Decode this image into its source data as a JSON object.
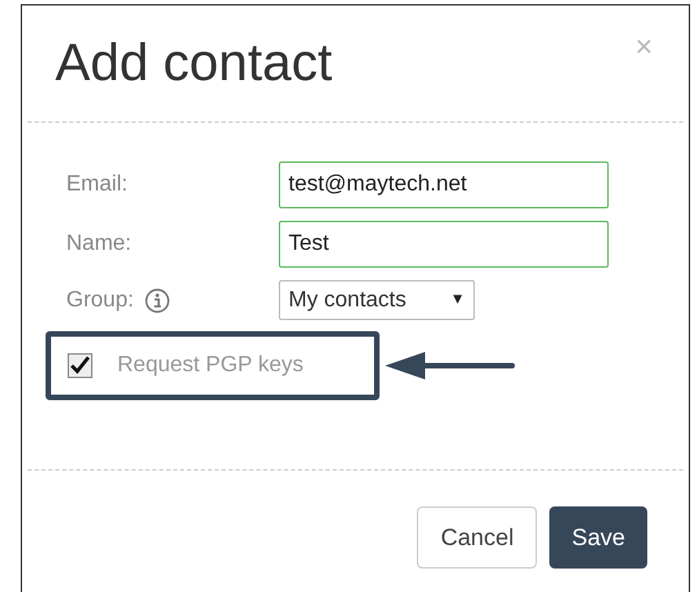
{
  "dialog": {
    "title": "Add contact",
    "close": "×",
    "fields": [
      {
        "kind": "text",
        "label": "Email:",
        "value": "test@maytech.net",
        "valid": true
      },
      {
        "kind": "text",
        "label": "Name:",
        "value": "Test",
        "valid": true
      },
      {
        "kind": "select",
        "label": "Group:",
        "info": true,
        "value": "My contacts",
        "caret": "▼"
      }
    ],
    "checkbox": {
      "label": "Request PGP keys",
      "checked": true
    },
    "buttons": [
      {
        "label": "Cancel",
        "kind": "secondary"
      },
      {
        "label": "Save",
        "kind": "primary"
      }
    ]
  }
}
